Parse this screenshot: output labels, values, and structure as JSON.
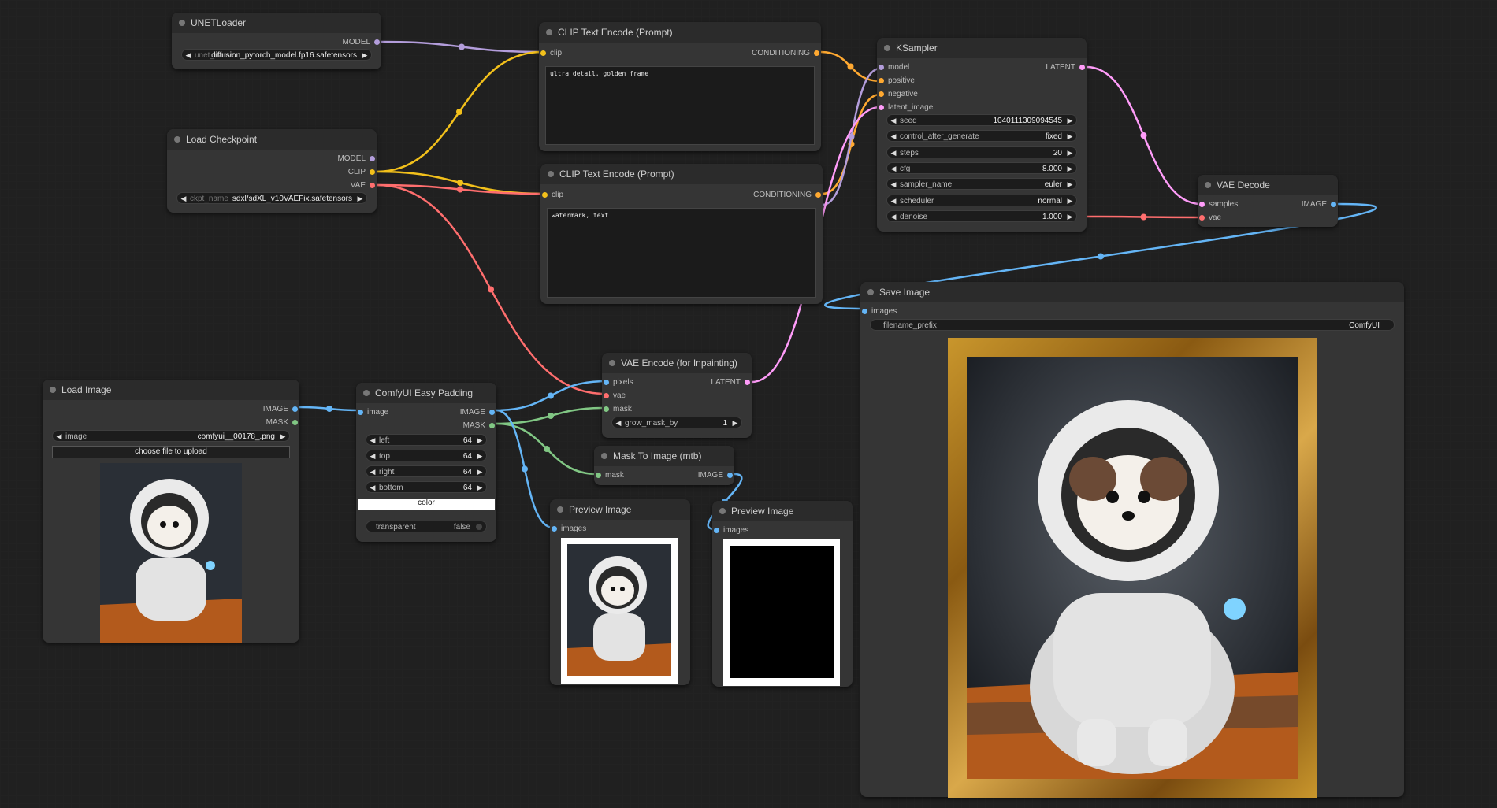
{
  "colors": {
    "model": "#b39ddb",
    "clip": "#f2c01b",
    "vae": "#ff6e6e",
    "conditioning": "#ffa931",
    "latent": "#ff9cf9",
    "image": "#64b5f6",
    "mask": "#81c784"
  },
  "unet": {
    "title": "UNETLoader",
    "out_model": "MODEL",
    "w_label": "unet_name",
    "w_value": "diffusion_pytorch_model.fp16.safetensors"
  },
  "ckpt": {
    "title": "Load Checkpoint",
    "out_model": "MODEL",
    "out_clip": "CLIP",
    "out_vae": "VAE",
    "w_label": "ckpt_name",
    "w_value": "sdxl/sdXL_v10VAEFix.safetensors"
  },
  "clip_pos": {
    "title": "CLIP Text Encode (Prompt)",
    "in_clip": "clip",
    "out_cond": "CONDITIONING",
    "text": "ultra detail, golden frame"
  },
  "clip_neg": {
    "title": "CLIP Text Encode (Prompt)",
    "in_clip": "clip",
    "out_cond": "CONDITIONING",
    "text": "watermark, text"
  },
  "ksampler": {
    "title": "KSampler",
    "in_model": "model",
    "in_positive": "positive",
    "in_negative": "negative",
    "in_latent": "latent_image",
    "out_latent": "LATENT",
    "widgets": [
      {
        "label": "seed",
        "value": "1040111309094545"
      },
      {
        "label": "control_after_generate",
        "value": "fixed"
      },
      {
        "label": "steps",
        "value": "20"
      },
      {
        "label": "cfg",
        "value": "8.000"
      },
      {
        "label": "sampler_name",
        "value": "euler"
      },
      {
        "label": "scheduler",
        "value": "normal"
      },
      {
        "label": "denoise",
        "value": "1.000"
      }
    ]
  },
  "vae_decode": {
    "title": "VAE Decode",
    "in_samples": "samples",
    "in_vae": "vae",
    "out_image": "IMAGE"
  },
  "save_image": {
    "title": "Save Image",
    "in_images": "images",
    "w_label": "filename_prefix",
    "w_value": "ComfyUI"
  },
  "load_image": {
    "title": "Load Image",
    "out_image": "IMAGE",
    "out_mask": "MASK",
    "w_label": "image",
    "w_value": "comfyui__00178_.png",
    "upload_label": "choose file to upload"
  },
  "padding": {
    "title": "ComfyUI Easy Padding",
    "in_image": "image",
    "out_image": "IMAGE",
    "out_mask": "MASK",
    "widgets": [
      {
        "label": "left",
        "value": "64"
      },
      {
        "label": "top",
        "value": "64"
      },
      {
        "label": "right",
        "value": "64"
      },
      {
        "label": "bottom",
        "value": "64"
      }
    ],
    "color_label": "color",
    "toggle_label": "transparent",
    "toggle_value": "false"
  },
  "vae_encode": {
    "title": "VAE Encode (for Inpainting)",
    "in_pixels": "pixels",
    "in_vae": "vae",
    "in_mask": "mask",
    "out_latent": "LATENT",
    "w_label": "grow_mask_by",
    "w_value": "1"
  },
  "mask_to_image": {
    "title": "Mask To Image (mtb)",
    "in_mask": "mask",
    "out_image": "IMAGE"
  },
  "preview1": {
    "title": "Preview Image",
    "in_images": "images"
  },
  "preview2": {
    "title": "Preview Image",
    "in_images": "images"
  }
}
